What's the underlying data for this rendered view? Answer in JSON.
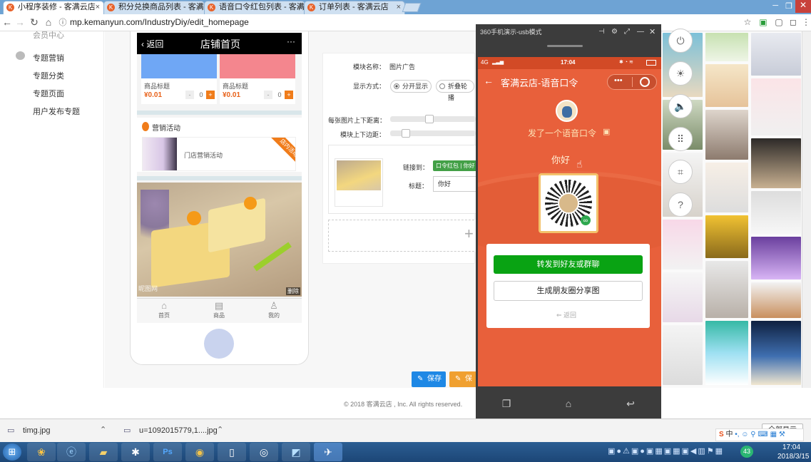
{
  "browser": {
    "tabs": [
      {
        "label": "小程序装修 - 客满云店"
      },
      {
        "label": "积分兑换商品列表 - 客满"
      },
      {
        "label": "语音口令红包列表 - 客满"
      },
      {
        "label": "订单列表 - 客满云店"
      }
    ],
    "url": "mp.kemanyun.com/IndustryDiy/edit_homepage"
  },
  "sidebar": {
    "top_partial": "会员中心",
    "section": "专题营销",
    "items": [
      "专题分类",
      "专题页面",
      "用户发布专题"
    ]
  },
  "phone_preview": {
    "back": "返回",
    "title": "店铺首页",
    "more": "···",
    "products": [
      {
        "title": "商品标题",
        "price": "¥0.01",
        "qty": "0"
      },
      {
        "title": "商品标题",
        "price": "¥0.01",
        "qty": "0"
      }
    ],
    "stepper_minus": "-",
    "stepper_plus": "+",
    "marketing_title": "营销活动",
    "marketing_item": "门店营销活动",
    "ribbon": "店内活动",
    "delete": "删除",
    "watermark": "昵图网",
    "nav": [
      "首页",
      "商品",
      "我的"
    ]
  },
  "form": {
    "module_name_label": "模块名称：",
    "module_name_value": "图片广告",
    "display_label": "显示方式：",
    "display_options": [
      "分开显示",
      "折叠轮播"
    ],
    "spacing_label": "每张图片上下距离：",
    "margin_label": "模块上下边距：",
    "link_label": "链接到：",
    "link_value": "口令红包 | 你好",
    "title_label": "标题：",
    "title_value": "你好",
    "add": "+",
    "save": "保存",
    "save2": "保存"
  },
  "footer": "© 2018 客满云店 , Inc. All rights reserved.",
  "emulator": {
    "window_title": "360手机演示-usb模式",
    "status_left": "4G",
    "status_time": "17:04",
    "miniapp_title": "客满云店-语音口令",
    "sent_text": "发了一个语音口令",
    "password": "你好",
    "forward_button": "转发到好友或群聊",
    "moments_button": "生成朋友圈分享图",
    "back": "返回"
  },
  "downloads": [
    {
      "name": "timg.jpg"
    },
    {
      "name": "u=1092015779,1....jpg"
    }
  ],
  "download_show_all": "全部显示",
  "tray": {
    "ime": "中",
    "time": "17:04",
    "date": "2018/3/15",
    "badge": "43"
  }
}
